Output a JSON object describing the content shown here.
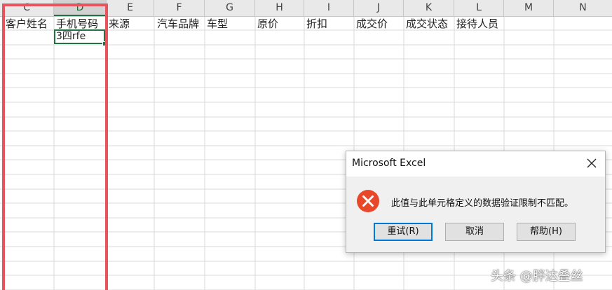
{
  "sheet": {
    "columns": [
      "C",
      "D",
      "E",
      "F",
      "G",
      "H",
      "I",
      "J",
      "K",
      "L",
      "M",
      "N"
    ],
    "selected_column": "D",
    "headers_row": [
      "客户姓名",
      "手机号码",
      "来源",
      "汽车品牌",
      "车型",
      "原价",
      "折扣",
      "成交价",
      "成交状态",
      "接待人员"
    ],
    "active_cell_value": "3四rfe"
  },
  "dialog": {
    "title": "Microsoft Excel",
    "message": "此值与此单元格定义的数据验证限制不匹配。",
    "buttons": [
      "重试(R)",
      "取消",
      "帮助(H)"
    ]
  },
  "watermark": "头条 @胖达叠丝",
  "colors": {
    "grid_header_bg": "#e9e9e9",
    "selection_green": "#217346",
    "highlight_red": "#e8545e",
    "error_red": "#e9472a"
  },
  "icons": [
    "close-icon",
    "error-icon"
  ]
}
